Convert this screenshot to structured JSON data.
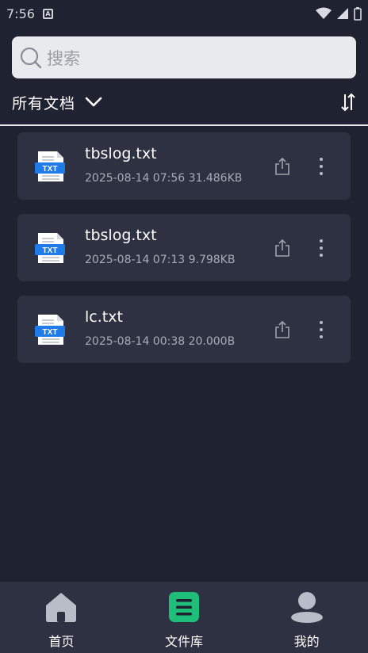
{
  "status_bar": {
    "time": "7:56"
  },
  "search": {
    "placeholder": "搜索"
  },
  "filter": {
    "label": "所有文档"
  },
  "files": [
    {
      "name": "tbslog.txt",
      "meta": "2025-08-14 07:56 31.486KB",
      "type_label": "TXT"
    },
    {
      "name": "tbslog.txt",
      "meta": "2025-08-14 07:13 9.798KB",
      "type_label": "TXT"
    },
    {
      "name": "lc.txt",
      "meta": "2025-08-14 00:38 20.000B",
      "type_label": "TXT"
    }
  ],
  "bottom_nav": {
    "items": [
      {
        "label": "首页",
        "icon": "home-icon",
        "active": false
      },
      {
        "label": "文件库",
        "icon": "file-library-icon",
        "active": true
      },
      {
        "label": "我的",
        "icon": "profile-icon",
        "active": false
      }
    ]
  },
  "colors": {
    "background": "#1f2230",
    "card": "#2d3142",
    "accent": "#1fbf7a",
    "txt_badge": "#1f7be8"
  }
}
